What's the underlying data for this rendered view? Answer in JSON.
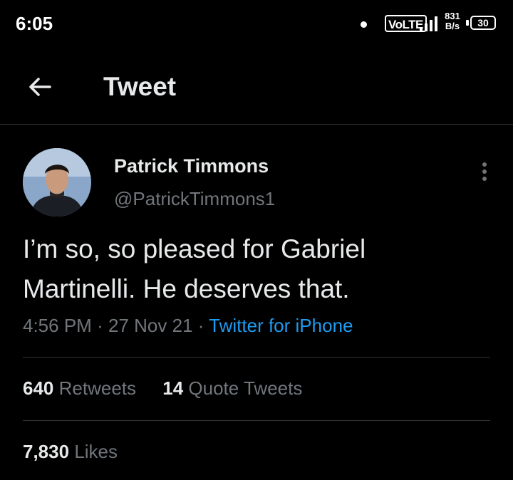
{
  "status_bar": {
    "time": "6:05",
    "network": "VoLTE",
    "speed_value": "831",
    "speed_unit": "B/s",
    "battery": "30"
  },
  "header": {
    "back_icon": "arrow-left-icon",
    "title": "Tweet"
  },
  "tweet": {
    "author_name": "Patrick Timmons",
    "author_handle": "@PatrickTimmons1",
    "more_icon": "more-vertical-icon",
    "text_line1": "I’m so, so pleased for Gabriel",
    "text_line2": "Martinelli. He deserves that.",
    "time": "4:56 PM",
    "date": "27 Nov 21",
    "separator": "·",
    "source": "Twitter for iPhone"
  },
  "stats": {
    "retweets_count": "640",
    "retweets_label": "Retweets",
    "quote_count": "14",
    "quote_label": "Quote Tweets",
    "likes_count": "7,830",
    "likes_label": "Likes"
  },
  "colors": {
    "background": "#000000",
    "text_primary": "#e7e9ea",
    "text_secondary": "#71767b",
    "accent": "#1d9bf0",
    "divider": "#2f3336"
  }
}
